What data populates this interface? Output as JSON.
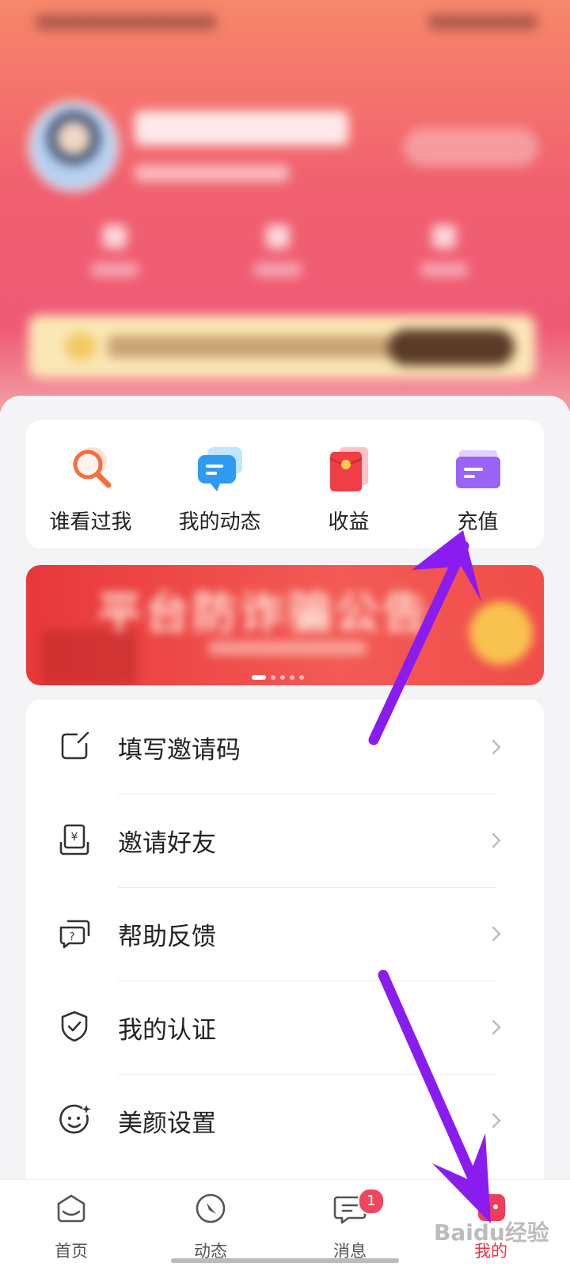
{
  "quick_actions": [
    {
      "label": "谁看过我",
      "icon": "magnifier-icon"
    },
    {
      "label": "我的动态",
      "icon": "chat-bubble-icon"
    },
    {
      "label": "收益",
      "icon": "red-envelope-icon"
    },
    {
      "label": "充值",
      "icon": "wallet-card-icon"
    }
  ],
  "banner": {
    "title": "平台防诈骗公告"
  },
  "menu": [
    {
      "label": "填写邀请码",
      "icon": "edit-square-icon"
    },
    {
      "label": "邀请好友",
      "icon": "yuan-invite-icon"
    },
    {
      "label": "帮助反馈",
      "icon": "help-chat-icon"
    },
    {
      "label": "我的认证",
      "icon": "shield-check-icon"
    },
    {
      "label": "美颜设置",
      "icon": "smile-sparkle-icon"
    }
  ],
  "tabbar": {
    "home": "首页",
    "discover": "动态",
    "messages": "消息",
    "messages_badge": "1",
    "mine": "我的"
  },
  "colors": {
    "accent": "#e8334a",
    "annotation_arrow": "#8a1cf0"
  }
}
